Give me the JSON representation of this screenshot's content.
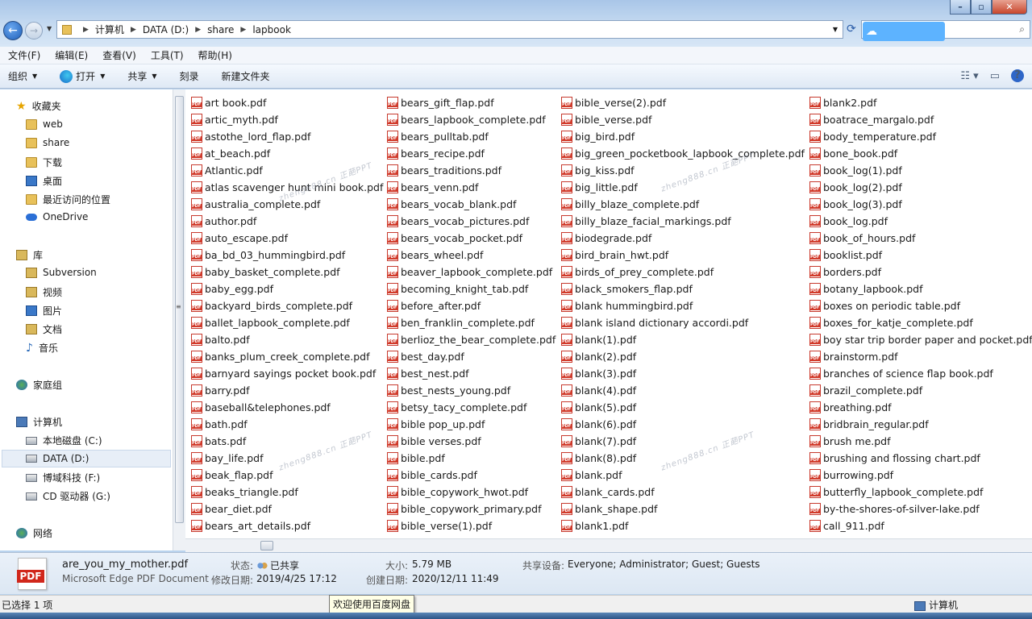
{
  "window": {
    "breadcrumbs": [
      "计算机",
      "DATA (D:)",
      "share",
      "lapbook"
    ]
  },
  "menu": [
    "文件(F)",
    "编辑(E)",
    "查看(V)",
    "工具(T)",
    "帮助(H)"
  ],
  "toolbar": {
    "organize": "组织",
    "open": "打开",
    "share": "共享",
    "burn": "刻录",
    "new_folder": "新建文件夹"
  },
  "nav": {
    "favorites": "收藏夹",
    "web": "web",
    "share": "share",
    "downloads": "下载",
    "desktop": "桌面",
    "recent": "最近访问的位置",
    "onedrive": "OneDrive",
    "library": "库",
    "subversion": "Subversion",
    "videos": "视频",
    "pictures": "图片",
    "documents": "文档",
    "music": "音乐",
    "homegroup": "家庭组",
    "computer": "计算机",
    "drive_c": "本地磁盘 (C:)",
    "drive_d": "DATA (D:)",
    "drive_f": "博域科技 (F:)",
    "drive_g": "CD 驱动器 (G:)",
    "network": "网络"
  },
  "files": {
    "col1": [
      "art book.pdf",
      "artic_myth.pdf",
      "astothe_lord_flap.pdf",
      "at_beach.pdf",
      "Atlantic.pdf",
      "atlas scavenger hunt mini book.pdf",
      "australia_complete.pdf",
      "author.pdf",
      "auto_escape.pdf",
      "ba_bd_03_hummingbird.pdf",
      "baby_basket_complete.pdf",
      "baby_egg.pdf",
      "backyard_birds_complete.pdf",
      "ballet_lapbook_complete.pdf",
      "balto.pdf",
      "banks_plum_creek_complete.pdf",
      "barnyard sayings pocket book.pdf",
      "barry.pdf",
      "baseball&telephones.pdf",
      "bath.pdf",
      "bats.pdf",
      "bay_life.pdf",
      "beak_flap.pdf",
      "beaks_triangle.pdf",
      "bear_diet.pdf",
      "bears_art_details.pdf"
    ],
    "col2": [
      "bears_gift_flap.pdf",
      "bears_lapbook_complete.pdf",
      "bears_pulltab.pdf",
      "bears_recipe.pdf",
      "bears_traditions.pdf",
      "bears_venn.pdf",
      "bears_vocab_blank.pdf",
      "bears_vocab_pictures.pdf",
      "bears_vocab_pocket.pdf",
      "bears_wheel.pdf",
      "beaver_lapbook_complete.pdf",
      "becoming_knight_tab.pdf",
      "before_after.pdf",
      "ben_franklin_complete.pdf",
      "berlioz_the_bear_complete.pdf",
      "best_day.pdf",
      "best_nest.pdf",
      "best_nests_young.pdf",
      "betsy_tacy_complete.pdf",
      "bible pop_up.pdf",
      "bible verses.pdf",
      "bible.pdf",
      "bible_cards.pdf",
      "bible_copywork_hwot.pdf",
      "bible_copywork_primary.pdf",
      "bible_verse(1).pdf"
    ],
    "col3": [
      "bible_verse(2).pdf",
      "bible_verse.pdf",
      "big_bird.pdf",
      "big_green_pocketbook_lapbook_complete.pdf",
      "big_kiss.pdf",
      "big_little.pdf",
      "billy_blaze_complete.pdf",
      "billy_blaze_facial_markings.pdf",
      "biodegrade.pdf",
      "bird_brain_hwt.pdf",
      "birds_of_prey_complete.pdf",
      "black_smokers_flap.pdf",
      "blank hummingbird.pdf",
      "blank island dictionary accordi.pdf",
      "blank(1).pdf",
      "blank(2).pdf",
      "blank(3).pdf",
      "blank(4).pdf",
      "blank(5).pdf",
      "blank(6).pdf",
      "blank(7).pdf",
      "blank(8).pdf",
      "blank.pdf",
      "blank_cards.pdf",
      "blank_shape.pdf",
      "blank1.pdf"
    ],
    "col4": [
      "blank2.pdf",
      "boatrace_margalo.pdf",
      "body_temperature.pdf",
      "bone_book.pdf",
      "book_log(1).pdf",
      "book_log(2).pdf",
      "book_log(3).pdf",
      "book_log.pdf",
      "book_of_hours.pdf",
      "booklist.pdf",
      "borders.pdf",
      "botany_lapbook.pdf",
      "boxes on periodic table.pdf",
      "boxes_for_katje_complete.pdf",
      "boy star trip border paper and pocket.pdf",
      "brainstorm.pdf",
      "branches of science flap book.pdf",
      "brazil_complete.pdf",
      "breathing.pdf",
      "bridbrain_regular.pdf",
      "brush me.pdf",
      "brushing and flossing chart.pdf",
      "burrowing.pdf",
      "butterfly_lapbook_complete.pdf",
      "by-the-shores-of-silver-lake.pdf",
      "call_911.pdf"
    ]
  },
  "watermark": "zheng888.cn 正葩PPT",
  "details": {
    "filename": "are_you_my_mother.pdf",
    "filetype": "Microsoft Edge PDF Document",
    "status_label": "状态:",
    "status_value": "已共享",
    "modified_label": "修改日期:",
    "modified_value": "2019/4/25 17:12",
    "size_label": "大小:",
    "size_value": "5.79 MB",
    "created_label": "创建日期:",
    "created_value": "2020/12/11 11:49",
    "shared_label": "共享设备:",
    "shared_value": "Everyone; Administrator; Guest; Guests"
  },
  "status": {
    "selected": "已选择 1 项",
    "tooltip": "欢迎使用百度网盘",
    "location": "计算机"
  }
}
